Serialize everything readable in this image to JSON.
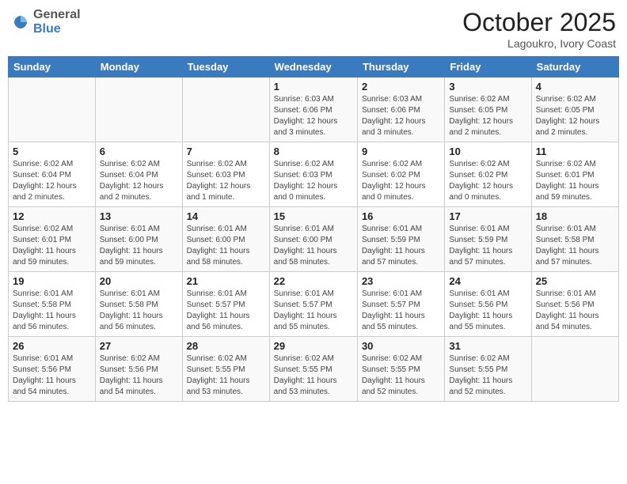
{
  "header": {
    "logo_general": "General",
    "logo_blue": "Blue",
    "month": "October 2025",
    "location": "Lagoukro, Ivory Coast"
  },
  "weekdays": [
    "Sunday",
    "Monday",
    "Tuesday",
    "Wednesday",
    "Thursday",
    "Friday",
    "Saturday"
  ],
  "weeks": [
    [
      {
        "day": "",
        "info": ""
      },
      {
        "day": "",
        "info": ""
      },
      {
        "day": "",
        "info": ""
      },
      {
        "day": "1",
        "info": "Sunrise: 6:03 AM\nSunset: 6:06 PM\nDaylight: 12 hours\nand 3 minutes."
      },
      {
        "day": "2",
        "info": "Sunrise: 6:03 AM\nSunset: 6:06 PM\nDaylight: 12 hours\nand 3 minutes."
      },
      {
        "day": "3",
        "info": "Sunrise: 6:02 AM\nSunset: 6:05 PM\nDaylight: 12 hours\nand 2 minutes."
      },
      {
        "day": "4",
        "info": "Sunrise: 6:02 AM\nSunset: 6:05 PM\nDaylight: 12 hours\nand 2 minutes."
      }
    ],
    [
      {
        "day": "5",
        "info": "Sunrise: 6:02 AM\nSunset: 6:04 PM\nDaylight: 12 hours\nand 2 minutes."
      },
      {
        "day": "6",
        "info": "Sunrise: 6:02 AM\nSunset: 6:04 PM\nDaylight: 12 hours\nand 2 minutes."
      },
      {
        "day": "7",
        "info": "Sunrise: 6:02 AM\nSunset: 6:03 PM\nDaylight: 12 hours\nand 1 minute."
      },
      {
        "day": "8",
        "info": "Sunrise: 6:02 AM\nSunset: 6:03 PM\nDaylight: 12 hours\nand 0 minutes."
      },
      {
        "day": "9",
        "info": "Sunrise: 6:02 AM\nSunset: 6:02 PM\nDaylight: 12 hours\nand 0 minutes."
      },
      {
        "day": "10",
        "info": "Sunrise: 6:02 AM\nSunset: 6:02 PM\nDaylight: 12 hours\nand 0 minutes."
      },
      {
        "day": "11",
        "info": "Sunrise: 6:02 AM\nSunset: 6:01 PM\nDaylight: 11 hours\nand 59 minutes."
      }
    ],
    [
      {
        "day": "12",
        "info": "Sunrise: 6:02 AM\nSunset: 6:01 PM\nDaylight: 11 hours\nand 59 minutes."
      },
      {
        "day": "13",
        "info": "Sunrise: 6:01 AM\nSunset: 6:00 PM\nDaylight: 11 hours\nand 59 minutes."
      },
      {
        "day": "14",
        "info": "Sunrise: 6:01 AM\nSunset: 6:00 PM\nDaylight: 11 hours\nand 58 minutes."
      },
      {
        "day": "15",
        "info": "Sunrise: 6:01 AM\nSunset: 6:00 PM\nDaylight: 11 hours\nand 58 minutes."
      },
      {
        "day": "16",
        "info": "Sunrise: 6:01 AM\nSunset: 5:59 PM\nDaylight: 11 hours\nand 57 minutes."
      },
      {
        "day": "17",
        "info": "Sunrise: 6:01 AM\nSunset: 5:59 PM\nDaylight: 11 hours\nand 57 minutes."
      },
      {
        "day": "18",
        "info": "Sunrise: 6:01 AM\nSunset: 5:58 PM\nDaylight: 11 hours\nand 57 minutes."
      }
    ],
    [
      {
        "day": "19",
        "info": "Sunrise: 6:01 AM\nSunset: 5:58 PM\nDaylight: 11 hours\nand 56 minutes."
      },
      {
        "day": "20",
        "info": "Sunrise: 6:01 AM\nSunset: 5:58 PM\nDaylight: 11 hours\nand 56 minutes."
      },
      {
        "day": "21",
        "info": "Sunrise: 6:01 AM\nSunset: 5:57 PM\nDaylight: 11 hours\nand 56 minutes."
      },
      {
        "day": "22",
        "info": "Sunrise: 6:01 AM\nSunset: 5:57 PM\nDaylight: 11 hours\nand 55 minutes."
      },
      {
        "day": "23",
        "info": "Sunrise: 6:01 AM\nSunset: 5:57 PM\nDaylight: 11 hours\nand 55 minutes."
      },
      {
        "day": "24",
        "info": "Sunrise: 6:01 AM\nSunset: 5:56 PM\nDaylight: 11 hours\nand 55 minutes."
      },
      {
        "day": "25",
        "info": "Sunrise: 6:01 AM\nSunset: 5:56 PM\nDaylight: 11 hours\nand 54 minutes."
      }
    ],
    [
      {
        "day": "26",
        "info": "Sunrise: 6:01 AM\nSunset: 5:56 PM\nDaylight: 11 hours\nand 54 minutes."
      },
      {
        "day": "27",
        "info": "Sunrise: 6:02 AM\nSunset: 5:56 PM\nDaylight: 11 hours\nand 54 minutes."
      },
      {
        "day": "28",
        "info": "Sunrise: 6:02 AM\nSunset: 5:55 PM\nDaylight: 11 hours\nand 53 minutes."
      },
      {
        "day": "29",
        "info": "Sunrise: 6:02 AM\nSunset: 5:55 PM\nDaylight: 11 hours\nand 53 minutes."
      },
      {
        "day": "30",
        "info": "Sunrise: 6:02 AM\nSunset: 5:55 PM\nDaylight: 11 hours\nand 52 minutes."
      },
      {
        "day": "31",
        "info": "Sunrise: 6:02 AM\nSunset: 5:55 PM\nDaylight: 11 hours\nand 52 minutes."
      },
      {
        "day": "",
        "info": ""
      }
    ]
  ]
}
